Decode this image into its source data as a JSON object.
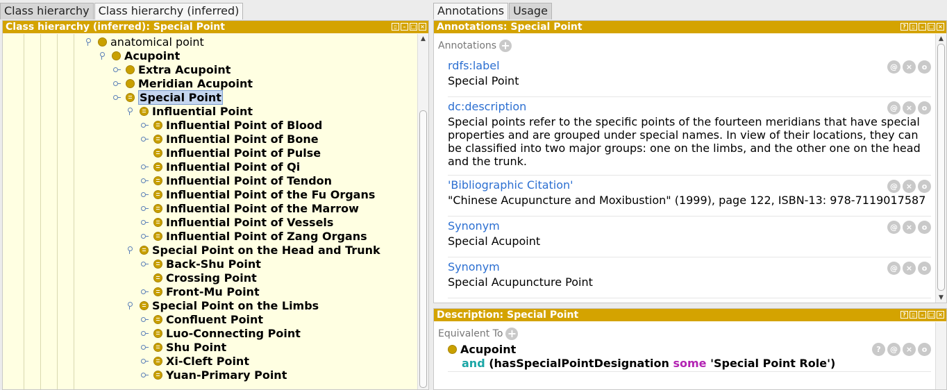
{
  "left_tabs": [
    "Class hierarchy",
    "Class hierarchy (inferred)"
  ],
  "left_selected_tab": 1,
  "right_tabs": [
    "Annotations",
    "Usage"
  ],
  "right_selected_tab": 0,
  "hierarchy": {
    "title": "Class hierarchy (inferred): Special Point",
    "rows": [
      {
        "label": "anatomical point",
        "level": 0,
        "handle": "open",
        "dot": "plain",
        "bold": false
      },
      {
        "label": "Acupoint",
        "level": 1,
        "handle": "open",
        "dot": "plain",
        "bold": true
      },
      {
        "label": "Extra Acupoint",
        "level": 2,
        "handle": "closed",
        "dot": "plain",
        "bold": true
      },
      {
        "label": "Meridian Acupoint",
        "level": 2,
        "handle": "closed",
        "dot": "plain",
        "bold": true
      },
      {
        "label": "Special Point",
        "level": 2,
        "handle": "closed",
        "dot": "def",
        "bold": true,
        "selected": true
      },
      {
        "label": "Influential Point",
        "level": 3,
        "handle": "open",
        "dot": "def",
        "bold": true
      },
      {
        "label": "Influential Point of Blood",
        "level": 4,
        "handle": "closed",
        "dot": "def",
        "bold": true
      },
      {
        "label": "Influential Point of Bone",
        "level": 4,
        "handle": "closed",
        "dot": "def",
        "bold": true
      },
      {
        "label": "Influential Point of Pulse",
        "level": 4,
        "handle": "none",
        "dot": "def",
        "bold": true
      },
      {
        "label": "Influential Point of Qi",
        "level": 4,
        "handle": "closed",
        "dot": "def",
        "bold": true
      },
      {
        "label": "Influential Point of Tendon",
        "level": 4,
        "handle": "closed",
        "dot": "def",
        "bold": true
      },
      {
        "label": "Influential Point of the Fu Organs",
        "level": 4,
        "handle": "closed",
        "dot": "def",
        "bold": true
      },
      {
        "label": "Influential Point of the Marrow",
        "level": 4,
        "handle": "closed",
        "dot": "def",
        "bold": true
      },
      {
        "label": "Influential Point of Vessels",
        "level": 4,
        "handle": "closed",
        "dot": "def",
        "bold": true
      },
      {
        "label": "Influential Point of Zang Organs",
        "level": 4,
        "handle": "closed",
        "dot": "def",
        "bold": true
      },
      {
        "label": "Special Point on the Head and Trunk",
        "level": 3,
        "handle": "open",
        "dot": "def",
        "bold": true
      },
      {
        "label": "Back-Shu Point",
        "level": 4,
        "handle": "closed",
        "dot": "def",
        "bold": true
      },
      {
        "label": "Crossing Point",
        "level": 4,
        "handle": "none",
        "dot": "def",
        "bold": true
      },
      {
        "label": "Front-Mu Point",
        "level": 4,
        "handle": "closed",
        "dot": "def",
        "bold": true
      },
      {
        "label": "Special Point on the Limbs",
        "level": 3,
        "handle": "open",
        "dot": "def",
        "bold": true
      },
      {
        "label": "Confluent Point",
        "level": 4,
        "handle": "closed",
        "dot": "def",
        "bold": true
      },
      {
        "label": "Luo-Connecting Point",
        "level": 4,
        "handle": "closed",
        "dot": "def",
        "bold": true
      },
      {
        "label": "Shu Point",
        "level": 4,
        "handle": "closed",
        "dot": "def",
        "bold": true
      },
      {
        "label": "Xi-Cleft Point",
        "level": 4,
        "handle": "closed",
        "dot": "def",
        "bold": true
      },
      {
        "label": "Yuan-Primary Point",
        "level": 4,
        "handle": "closed",
        "dot": "def",
        "bold": true
      }
    ]
  },
  "annotations": {
    "title": "Annotations: Special Point",
    "section_label": "Annotations",
    "items": [
      {
        "property": "rdfs:label",
        "value": "Special Point"
      },
      {
        "property": "dc:description",
        "value": "Special points refer to the specific points of the fourteen meridians that have special properties and are grouped under special names. In view of their locations, they can be classified into two major groups: one on the limbs, and the other one on the head and the trunk."
      },
      {
        "property": "'Bibliographic Citation'",
        "value": "\"Chinese Acupuncture and Moxibustion\" (1999), page 122, ISBN-13: 978-7119017587"
      },
      {
        "property": "Synonym",
        "value": "Special Acupoint"
      },
      {
        "property": "Synonym",
        "value": "Special Acupuncture Point"
      }
    ]
  },
  "description": {
    "title": "Description: Special Point",
    "section_label": "Equivalent To",
    "class_name": "Acupoint",
    "kw_and": "and",
    "open_paren": "(",
    "property": "hasSpecialPointDesignation",
    "kw_some": "some",
    "filler": "'Special Point Role')"
  },
  "icons": {
    "help": "?",
    "at": "@",
    "remove": "×",
    "edit": "o",
    "plus": "+"
  },
  "colors": {
    "header": "#d4a300",
    "tree_bg": "#ffffe2",
    "property_link": "#2c6fd1",
    "kw_and": "#1aa6a6",
    "kw_some": "#b324b3"
  }
}
